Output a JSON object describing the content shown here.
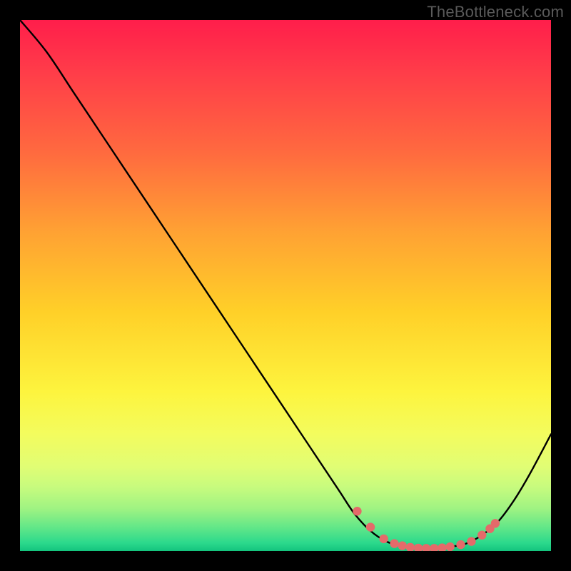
{
  "watermark": "TheBottleneck.com",
  "chart_data": {
    "type": "line",
    "title": "",
    "xlabel": "",
    "ylabel": "",
    "xlim": [
      0,
      100
    ],
    "ylim": [
      0,
      100
    ],
    "series": [
      {
        "name": "curve",
        "x": [
          0,
          5,
          10,
          15,
          20,
          25,
          30,
          35,
          40,
          45,
          50,
          55,
          60,
          63,
          66,
          69,
          72,
          75,
          78,
          81,
          84,
          87,
          90,
          93,
          96,
          100
        ],
        "y": [
          100,
          94,
          86.5,
          79,
          71.5,
          64,
          56.5,
          49,
          41.5,
          34,
          26.5,
          19,
          11.5,
          7,
          3.8,
          1.8,
          0.9,
          0.5,
          0.5,
          0.8,
          1.4,
          3.0,
          5.5,
          9.5,
          14.5,
          22
        ],
        "color": "#000000",
        "markers": false
      },
      {
        "name": "points",
        "x": [
          63.5,
          66.0,
          68.5,
          70.5,
          72.0,
          73.5,
          75.0,
          76.5,
          78.0,
          79.5,
          81.0,
          83.0,
          85.0,
          87.0,
          88.5,
          89.5
        ],
        "y": [
          7.5,
          4.5,
          2.3,
          1.4,
          1.0,
          0.7,
          0.55,
          0.5,
          0.5,
          0.6,
          0.8,
          1.2,
          1.8,
          3.0,
          4.2,
          5.2
        ],
        "color": "#e46a6a",
        "markers": true
      }
    ],
    "background_gradient": {
      "stops": [
        {
          "offset": 0.0,
          "color": "#ff1e4b"
        },
        {
          "offset": 0.1,
          "color": "#ff3d49"
        },
        {
          "offset": 0.25,
          "color": "#ff6a3f"
        },
        {
          "offset": 0.4,
          "color": "#ffa233"
        },
        {
          "offset": 0.55,
          "color": "#ffd028"
        },
        {
          "offset": 0.7,
          "color": "#fdf43e"
        },
        {
          "offset": 0.78,
          "color": "#f3fc5e"
        },
        {
          "offset": 0.84,
          "color": "#e1fd74"
        },
        {
          "offset": 0.88,
          "color": "#c7fb7e"
        },
        {
          "offset": 0.92,
          "color": "#9ff382"
        },
        {
          "offset": 0.955,
          "color": "#63e788"
        },
        {
          "offset": 0.985,
          "color": "#2bd98c"
        },
        {
          "offset": 1.0,
          "color": "#14c47e"
        }
      ]
    }
  }
}
